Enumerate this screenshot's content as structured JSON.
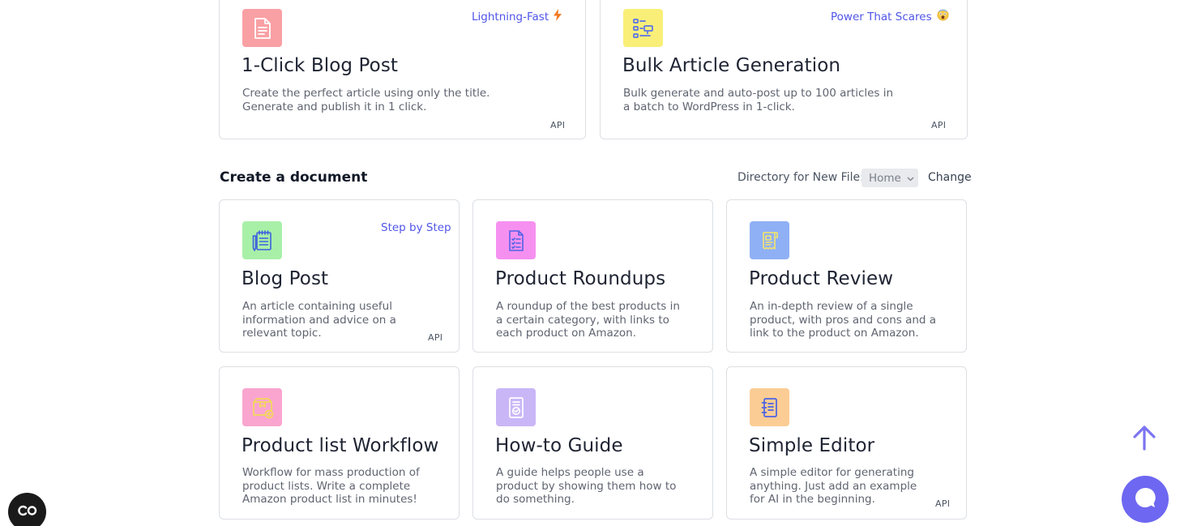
{
  "top_cards": [
    {
      "title": "1-Click Blog Post",
      "description": "Create the perfect article using only the title. Generate and publish it in 1 click.",
      "badge": "Lightning-Fast",
      "badge_icon": "lightning-icon",
      "api": "API",
      "icon": "document-icon",
      "icon_bg": "#f9a0a4"
    },
    {
      "title": "Bulk Article Generation",
      "description": "Bulk generate and auto-post up to 100 articles in a batch to WordPress in 1-click.",
      "badge": "Power That Scares",
      "badge_icon": "scared-face-emoji-icon",
      "api": "API",
      "icon": "flowchart-icon",
      "icon_bg": "#f9ef78"
    }
  ],
  "section": {
    "title": "Create a document",
    "directory_label": "Directory for New File:",
    "directory_value": "Home",
    "change_label": "Change"
  },
  "doc_cards": [
    {
      "title": "Blog Post",
      "description": "An article containing useful information and advice on a relevant topic.",
      "badge": "Step by Step",
      "api": "API",
      "icon": "notepad-icon",
      "icon_bg": "#a8f0a8"
    },
    {
      "title": "Product Roundups",
      "description": "A roundup of the best products in a certain category, with links to each product on Amazon.",
      "icon": "checklist-icon",
      "icon_bg": "#f690f0"
    },
    {
      "title": "Product Review",
      "description": "An in-depth review of a single product, with pros and cons and a link to the product on Amazon.",
      "icon": "receipt-icon",
      "icon_bg": "#8fb0f5"
    },
    {
      "title": "Product list Workflow",
      "description": "Workflow for mass production of product lists. Write a complete Amazon product list in minutes!",
      "icon": "box-add-icon",
      "icon_bg": "#f9a5cf"
    },
    {
      "title": "How-to Guide",
      "description": "A guide helps people use a product by showing them how to do something.",
      "icon": "guide-check-icon",
      "icon_bg": "#c9b6f7"
    },
    {
      "title": "Simple Editor",
      "description": "A simple editor for generating anything. Just add an example for AI in the beginning.",
      "api": "API",
      "icon": "notebook-icon",
      "icon_bg": "#fbcd95"
    }
  ],
  "colors": {
    "accent": "#4f55e8",
    "chat_bubble": "#6e67f1",
    "scroll_arrow": "#7c74f2"
  }
}
